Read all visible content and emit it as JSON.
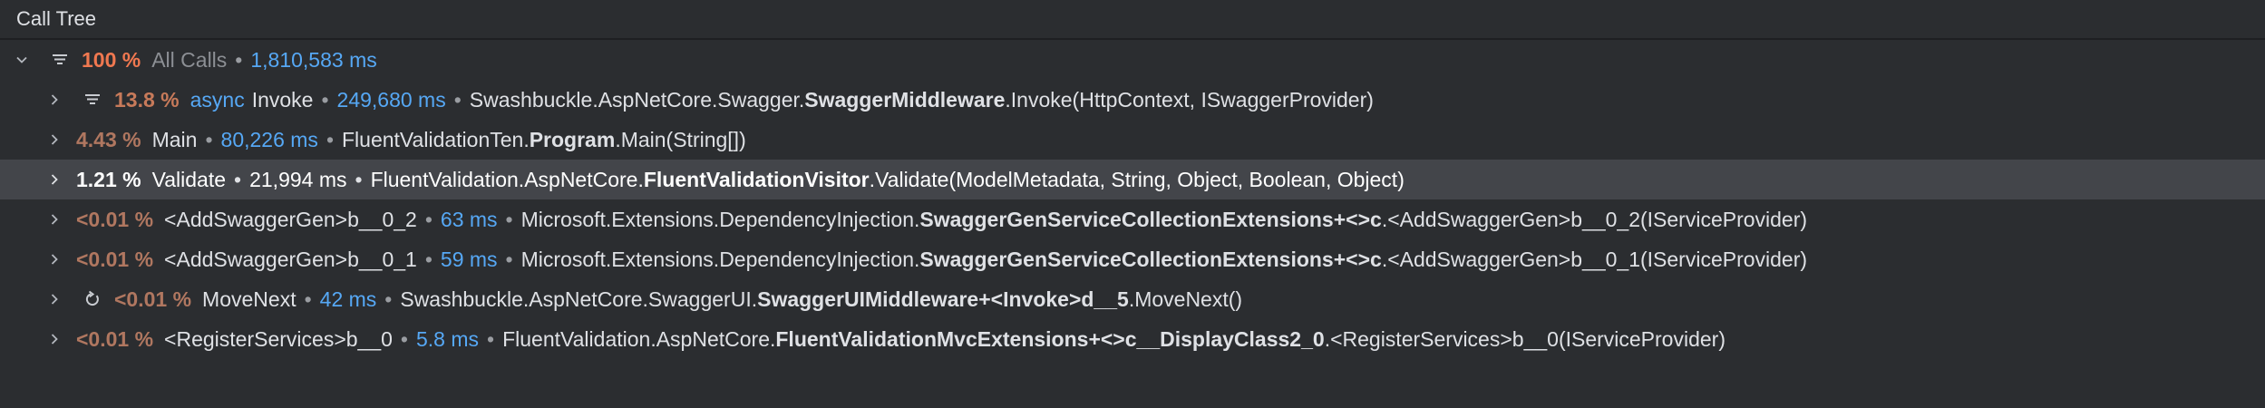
{
  "panel": {
    "title": "Call Tree"
  },
  "separator": "•",
  "rows": [
    {
      "percent": "100 %",
      "name": "All Calls",
      "time": "1,810,583 ms"
    },
    {
      "percent": "13.8 %",
      "keyword": "async",
      "name": "Invoke",
      "time": "249,680 ms",
      "ns": "Swashbuckle.AspNetCore.Swagger.",
      "cls": "SwaggerMiddleware",
      "method": ".Invoke(HttpContext, ISwaggerProvider)"
    },
    {
      "percent": "4.43 %",
      "name": "Main",
      "time": "80,226 ms",
      "ns": "FluentValidationTen.",
      "cls": "Program",
      "method": ".Main(String[])"
    },
    {
      "percent": "1.21 %",
      "name": "Validate",
      "time": "21,994 ms",
      "ns": "FluentValidation.AspNetCore.",
      "cls": "FluentValidationVisitor",
      "method": ".Validate(ModelMetadata, String, Object, Boolean, Object)"
    },
    {
      "percent": "<0.01 %",
      "name": "<AddSwaggerGen>b__0_2",
      "time": "63 ms",
      "ns": "Microsoft.Extensions.DependencyInjection.",
      "cls": "SwaggerGenServiceCollectionExtensions+<>c",
      "method": ".<AddSwaggerGen>b__0_2(IServiceProvider)"
    },
    {
      "percent": "<0.01 %",
      "name": "<AddSwaggerGen>b__0_1",
      "time": "59 ms",
      "ns": "Microsoft.Extensions.DependencyInjection.",
      "cls": "SwaggerGenServiceCollectionExtensions+<>c",
      "method": ".<AddSwaggerGen>b__0_1(IServiceProvider)"
    },
    {
      "percent": "<0.01 %",
      "name": "MoveNext",
      "time": "42 ms",
      "ns": "Swashbuckle.AspNetCore.SwaggerUI.",
      "cls": "SwaggerUIMiddleware+<Invoke>d__5",
      "method": ".MoveNext()"
    },
    {
      "percent": "<0.01 %",
      "name": "<RegisterServices>b__0",
      "time": "5.8 ms",
      "ns": "FluentValidation.AspNetCore.",
      "cls": "FluentValidationMvcExtensions+<>c__DisplayClass2_0",
      "method": ".<RegisterServices>b__0(IServiceProvider)"
    }
  ],
  "colors": {
    "background": "#2b2d30",
    "selected_row": "#43454a",
    "time_blue": "#56a8f5",
    "percent_hot": "#f07850"
  },
  "icons": {
    "expanded": "chevron-down-icon",
    "collapsed": "chevron-right-icon",
    "filter": "filter-icon",
    "recursion": "recursion-icon"
  }
}
